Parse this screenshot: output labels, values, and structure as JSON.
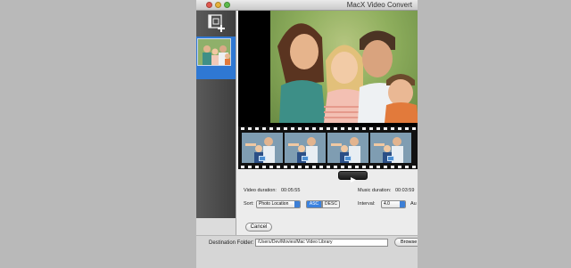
{
  "window": {
    "title": "MacX Video Convert"
  },
  "sidebar": {
    "add_icon": "add-photos-icon",
    "selected_index": 0
  },
  "preview": {
    "main_image": "family-photo",
    "play_icon": "play-icon",
    "frames": 4
  },
  "info": {
    "video_duration_label": "Video duration:",
    "video_duration_value": "00:05:55",
    "music_duration_label": "Music duration:",
    "music_duration_value": "00:03:59"
  },
  "sort": {
    "label": "Sort:",
    "selected": "Photo Location",
    "asc_label": "ASC",
    "desc_label": "DESC"
  },
  "interval": {
    "label": "Interval:",
    "value": "4.0",
    "extra_label": "Au"
  },
  "buttons": {
    "cancel": "Cancel",
    "browse": "Browse"
  },
  "destination": {
    "label": "Destination Folder:",
    "path": "/Users/Dev/Movies/Mac Video Library"
  },
  "colors": {
    "accent": "#2f78d3",
    "selected_segment": "#3a82e0",
    "sidebar": "#4a4a4a"
  }
}
